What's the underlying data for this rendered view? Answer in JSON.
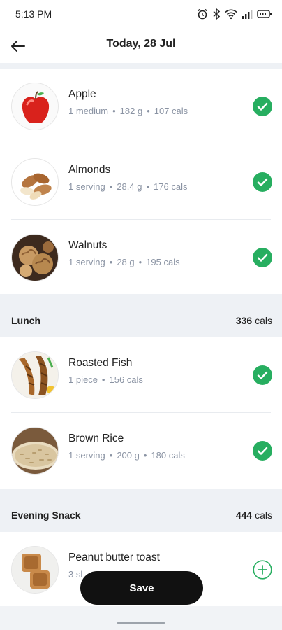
{
  "status_bar": {
    "time": "5:13 PM",
    "icons": [
      "alarm-icon",
      "bluetooth-icon",
      "wifi-icon",
      "signal-icon",
      "battery-icon"
    ]
  },
  "header": {
    "title": "Today, 28 Jul",
    "back_icon": "arrow-left-icon"
  },
  "breakfast_items": [
    {
      "name": "Apple",
      "meta": [
        "1 medium",
        "182 g",
        "107 cals"
      ],
      "logged": true,
      "image": "apple"
    },
    {
      "name": "Almonds",
      "meta": [
        "1 serving",
        "28.4 g",
        "176 cals"
      ],
      "logged": true,
      "image": "almonds"
    },
    {
      "name": "Walnuts",
      "meta": [
        "1 serving",
        "28 g",
        "195 cals"
      ],
      "logged": true,
      "image": "walnuts"
    }
  ],
  "lunch": {
    "title": "Lunch",
    "cals_value": "336",
    "cals_unit": "cals",
    "items": [
      {
        "name": "Roasted Fish",
        "meta": [
          "1 piece",
          "156 cals"
        ],
        "logged": true,
        "image": "fish"
      },
      {
        "name": "Brown Rice",
        "meta": [
          "1 serving",
          "200 g",
          "180 cals"
        ],
        "logged": true,
        "image": "rice"
      }
    ]
  },
  "evening_snack": {
    "title": "Evening Snack",
    "cals_value": "444",
    "cals_unit": "cals",
    "items": [
      {
        "name": "Peanut butter toast",
        "meta": [
          "3 sl"
        ],
        "logged": false,
        "image": "toast"
      }
    ]
  },
  "save_label": "Save",
  "colors": {
    "accent_green": "#27ae60",
    "section_bg": "#eef1f5",
    "meta_text": "#8a93a3",
    "save_bg": "#111111"
  },
  "separator": "•"
}
